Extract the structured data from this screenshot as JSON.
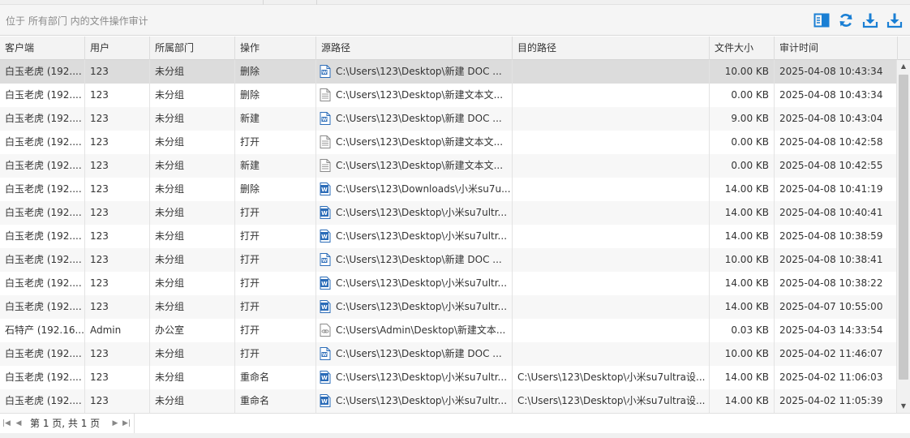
{
  "toolbar": {
    "location_text": "位于 所有部门 内的文件操作审计",
    "buttons": [
      {
        "name": "column-settings-icon"
      },
      {
        "name": "refresh-icon"
      },
      {
        "name": "export-icon"
      },
      {
        "name": "download-icon"
      }
    ],
    "accent_color": "#1a7fd4"
  },
  "columns": [
    "客户端",
    "用户",
    "所属部门",
    "操作",
    "源路径",
    "目的路径",
    "文件大小",
    "审计时间"
  ],
  "rows": [
    {
      "client": "白玉老虎 (192....",
      "user": "123",
      "dept": "未分组",
      "op": "删除",
      "icon": "word-icon",
      "src": "C:\\Users\\123\\Desktop\\新建 DOC ...",
      "dst": "",
      "size": "10.00 KB",
      "time": "2025-04-08 10:43:34",
      "selected": true
    },
    {
      "client": "白玉老虎 (192....",
      "user": "123",
      "dept": "未分组",
      "op": "删除",
      "icon": "text-file-icon",
      "src": "C:\\Users\\123\\Desktop\\新建文本文...",
      "dst": "",
      "size": "0.00 KB",
      "time": "2025-04-08 10:43:34"
    },
    {
      "client": "白玉老虎 (192....",
      "user": "123",
      "dept": "未分组",
      "op": "新建",
      "icon": "word-icon",
      "src": "C:\\Users\\123\\Desktop\\新建 DOC ...",
      "dst": "",
      "size": "9.00 KB",
      "time": "2025-04-08 10:43:04"
    },
    {
      "client": "白玉老虎 (192....",
      "user": "123",
      "dept": "未分组",
      "op": "打开",
      "icon": "text-file-icon",
      "src": "C:\\Users\\123\\Desktop\\新建文本文...",
      "dst": "",
      "size": "0.00 KB",
      "time": "2025-04-08 10:42:58"
    },
    {
      "client": "白玉老虎 (192....",
      "user": "123",
      "dept": "未分组",
      "op": "新建",
      "icon": "text-file-icon",
      "src": "C:\\Users\\123\\Desktop\\新建文本文...",
      "dst": "",
      "size": "0.00 KB",
      "time": "2025-04-08 10:42:55"
    },
    {
      "client": "白玉老虎 (192....",
      "user": "123",
      "dept": "未分组",
      "op": "删除",
      "icon": "word-docx-icon",
      "src": "C:\\Users\\123\\Downloads\\小米su7u...",
      "dst": "",
      "size": "14.00 KB",
      "time": "2025-04-08 10:41:19"
    },
    {
      "client": "白玉老虎 (192....",
      "user": "123",
      "dept": "未分组",
      "op": "打开",
      "icon": "word-docx-icon",
      "src": "C:\\Users\\123\\Desktop\\小米su7ultr...",
      "dst": "",
      "size": "14.00 KB",
      "time": "2025-04-08 10:40:41"
    },
    {
      "client": "白玉老虎 (192....",
      "user": "123",
      "dept": "未分组",
      "op": "打开",
      "icon": "word-docx-icon",
      "src": "C:\\Users\\123\\Desktop\\小米su7ultr...",
      "dst": "",
      "size": "14.00 KB",
      "time": "2025-04-08 10:38:59"
    },
    {
      "client": "白玉老虎 (192....",
      "user": "123",
      "dept": "未分组",
      "op": "打开",
      "icon": "word-icon",
      "src": "C:\\Users\\123\\Desktop\\新建 DOC ...",
      "dst": "",
      "size": "10.00 KB",
      "time": "2025-04-08 10:38:41"
    },
    {
      "client": "白玉老虎 (192....",
      "user": "123",
      "dept": "未分组",
      "op": "打开",
      "icon": "word-docx-icon",
      "src": "C:\\Users\\123\\Desktop\\小米su7ultr...",
      "dst": "",
      "size": "14.00 KB",
      "time": "2025-04-08 10:38:22"
    },
    {
      "client": "白玉老虎 (192....",
      "user": "123",
      "dept": "未分组",
      "op": "打开",
      "icon": "word-docx-icon",
      "src": "C:\\Users\\123\\Desktop\\小米su7ultr...",
      "dst": "",
      "size": "14.00 KB",
      "time": "2025-04-07 10:55:00"
    },
    {
      "client": "石特产 (192.16...",
      "user": "Admin",
      "dept": "办公室",
      "op": "打开",
      "icon": "link-file-icon",
      "src": "C:\\Users\\Admin\\Desktop\\新建文本...",
      "dst": "",
      "size": "0.03 KB",
      "time": "2025-04-03 14:33:54"
    },
    {
      "client": "白玉老虎 (192....",
      "user": "123",
      "dept": "未分组",
      "op": "打开",
      "icon": "word-icon",
      "src": "C:\\Users\\123\\Desktop\\新建 DOC ...",
      "dst": "",
      "size": "10.00 KB",
      "time": "2025-04-02 11:46:07"
    },
    {
      "client": "白玉老虎 (192....",
      "user": "123",
      "dept": "未分组",
      "op": "重命名",
      "icon": "word-docx-icon",
      "src": "C:\\Users\\123\\Desktop\\小米su7ultr...",
      "dst": "C:\\Users\\123\\Desktop\\小米su7ultra设...",
      "size": "14.00 KB",
      "time": "2025-04-02 11:06:03"
    },
    {
      "client": "白玉老虎 (192....",
      "user": "123",
      "dept": "未分组",
      "op": "重命名",
      "icon": "word-docx-icon",
      "src": "C:\\Users\\123\\Desktop\\小米su7ultr...",
      "dst": "C:\\Users\\123\\Desktop\\小米su7ultra设...",
      "size": "14.00 KB",
      "time": "2025-04-02 11:05:39"
    }
  ],
  "pager": {
    "first_icon": "first-page-icon",
    "prev_icon": "prev-page-icon",
    "page_info": "第 1 页, 共 1 页",
    "next_icon": "next-page-icon",
    "last_icon": "last-page-icon"
  }
}
